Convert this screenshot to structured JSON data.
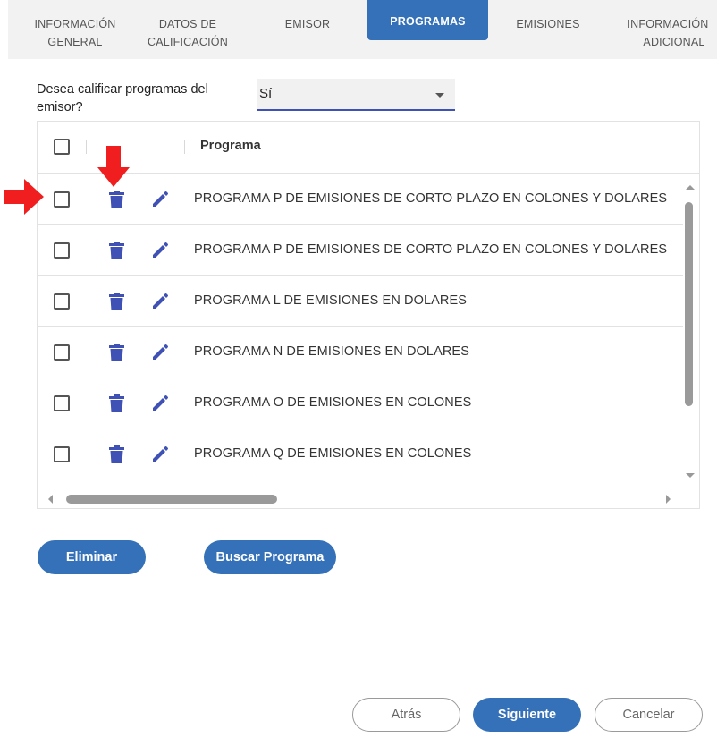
{
  "tabs": [
    {
      "label_line1": "INFORMACIÓN",
      "label_line2": "GENERAL",
      "active": false
    },
    {
      "label_line1": "DATOS DE",
      "label_line2": "CALIFICACIÓN",
      "active": false
    },
    {
      "label_line1": "EMISOR",
      "label_line2": "",
      "active": false
    },
    {
      "label_line1": "PROGRAMAS",
      "label_line2": "",
      "active": true
    },
    {
      "label_line1": "EMISIONES",
      "label_line2": "",
      "active": false
    },
    {
      "label_line1": "INFORMACIÓN",
      "label_line2": "ADICIONAL",
      "active": false
    }
  ],
  "question": {
    "label": "Desea calificar programas del emisor?",
    "selected_value": "Sí"
  },
  "grid": {
    "column_header": "Programa",
    "rows": [
      {
        "program": "PROGRAMA P DE EMISIONES DE CORTO PLAZO EN COLONES Y DOLARES"
      },
      {
        "program": "PROGRAMA P DE EMISIONES DE CORTO PLAZO EN COLONES Y DOLARES"
      },
      {
        "program": "PROGRAMA L DE EMISIONES EN DOLARES"
      },
      {
        "program": "PROGRAMA N DE EMISIONES EN DOLARES"
      },
      {
        "program": "PROGRAMA O DE EMISIONES EN COLONES"
      },
      {
        "program": "PROGRAMA Q DE EMISIONES EN COLONES"
      }
    ]
  },
  "actions": {
    "delete_label": "Eliminar",
    "search_label": "Buscar Programa"
  },
  "footer": {
    "back_label": "Atrás",
    "next_label": "Siguiente",
    "cancel_label": "Cancelar"
  },
  "colors": {
    "primary": "#3571b8",
    "icon": "#3f51b5",
    "annotation_arrow": "#f01e1e"
  },
  "icons": [
    "trash-icon",
    "pencil-icon",
    "chevron-down-icon",
    "red-arrow-down-icon",
    "red-arrow-right-icon"
  ]
}
